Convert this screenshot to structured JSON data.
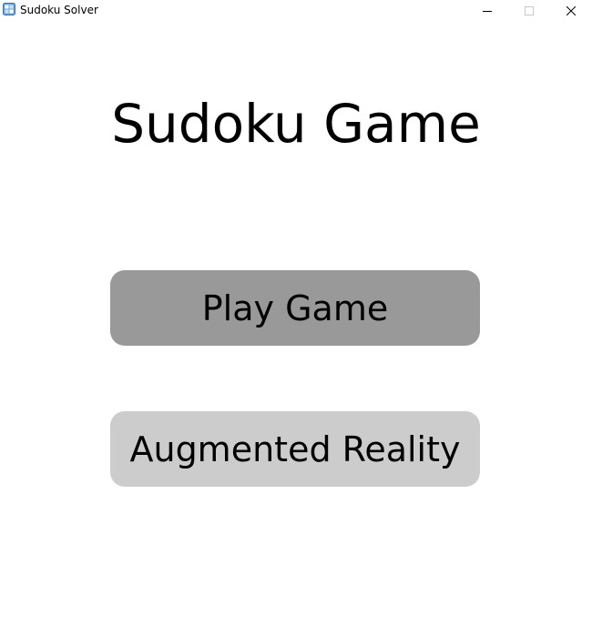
{
  "window": {
    "title": "Sudoku Solver",
    "icon": "sudoku-app-icon",
    "controls": {
      "minimize": "minimize-icon",
      "maximize": "maximize-icon",
      "close": "close-icon"
    }
  },
  "main": {
    "heading": "Sudoku Game",
    "play_label": "Play Game",
    "ar_label": "Augmented Reality"
  },
  "colors": {
    "play_button_bg": "#999999",
    "ar_button_bg": "#cccccc",
    "background": "#ffffff"
  }
}
